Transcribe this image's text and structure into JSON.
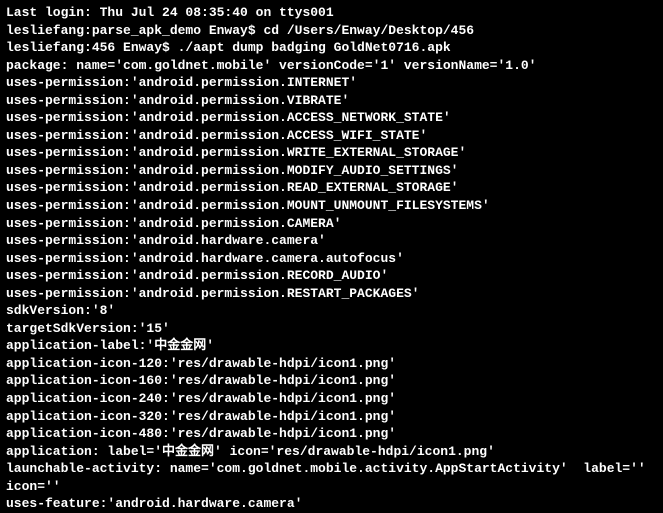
{
  "lines": [
    "Last login: Thu Jul 24 08:35:40 on ttys001",
    "lesliefang:parse_apk_demo Enway$ cd /Users/Enway/Desktop/456",
    "lesliefang:456 Enway$ ./aapt dump badging GoldNet0716.apk",
    "package: name='com.goldnet.mobile' versionCode='1' versionName='1.0'",
    "uses-permission:'android.permission.INTERNET'",
    "uses-permission:'android.permission.VIBRATE'",
    "uses-permission:'android.permission.ACCESS_NETWORK_STATE'",
    "uses-permission:'android.permission.ACCESS_WIFI_STATE'",
    "uses-permission:'android.permission.WRITE_EXTERNAL_STORAGE'",
    "uses-permission:'android.permission.MODIFY_AUDIO_SETTINGS'",
    "uses-permission:'android.permission.READ_EXTERNAL_STORAGE'",
    "uses-permission:'android.permission.MOUNT_UNMOUNT_FILESYSTEMS'",
    "uses-permission:'android.permission.CAMERA'",
    "uses-permission:'android.hardware.camera'",
    "uses-permission:'android.hardware.camera.autofocus'",
    "uses-permission:'android.permission.RECORD_AUDIO'",
    "uses-permission:'android.permission.RESTART_PACKAGES'",
    "sdkVersion:'8'",
    "targetSdkVersion:'15'",
    "application-label:'中金金网'",
    "application-icon-120:'res/drawable-hdpi/icon1.png'",
    "application-icon-160:'res/drawable-hdpi/icon1.png'",
    "application-icon-240:'res/drawable-hdpi/icon1.png'",
    "application-icon-320:'res/drawable-hdpi/icon1.png'",
    "application-icon-480:'res/drawable-hdpi/icon1.png'",
    "application: label='中金金网' icon='res/drawable-hdpi/icon1.png'",
    "launchable-activity: name='com.goldnet.mobile.activity.AppStartActivity'  label='' icon=''",
    "uses-feature:'android.hardware.camera'"
  ]
}
